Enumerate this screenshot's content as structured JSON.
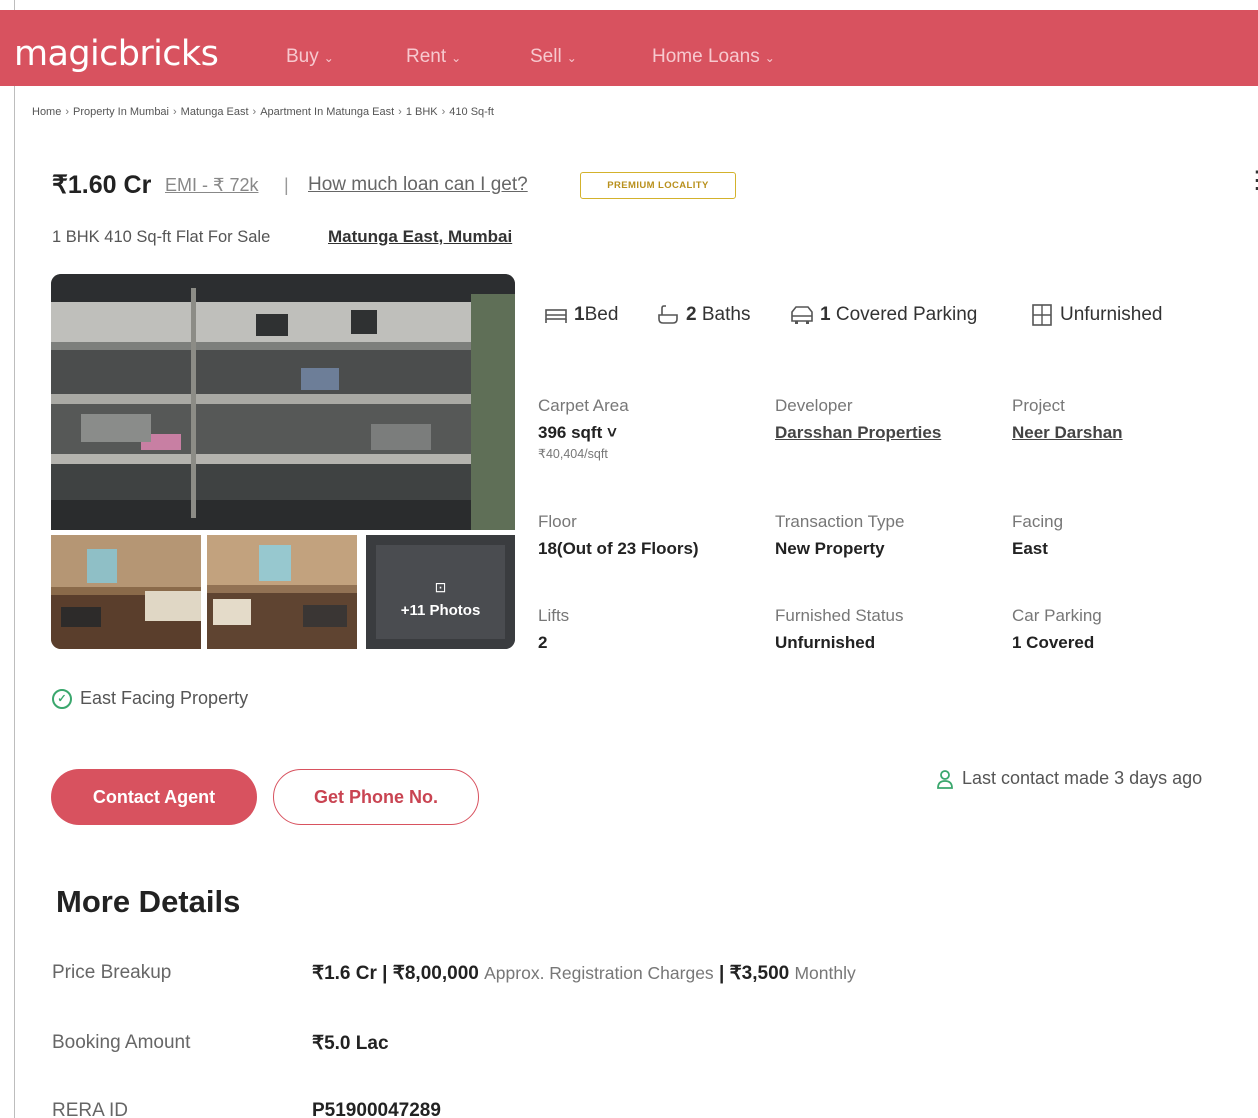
{
  "header": {
    "logo": "magicbricks",
    "nav": [
      {
        "label": "Buy"
      },
      {
        "label": "Rent"
      },
      {
        "label": "Sell"
      },
      {
        "label": "Home Loans"
      }
    ]
  },
  "breadcrumb": [
    "Home",
    "Property In Mumbai",
    "Matunga East",
    "Apartment In Matunga East",
    "1 BHK",
    "410 Sq-ft"
  ],
  "listing": {
    "price": "₹1.60 Cr",
    "emi": "EMI - ₹ 72k",
    "loan_link": "How much loan can I get?",
    "premium_badge": "PREMIUM LOCALITY",
    "subtitle": "1 BHK 410 Sq-ft Flat For Sale",
    "locality": "Matunga East, Mumbai"
  },
  "gallery": {
    "more_photos": "+11 Photos"
  },
  "amenities": {
    "bed_num": "1",
    "bed_label": "Bed",
    "bath_num": "2",
    "bath_label": "Baths",
    "parking_num": "1",
    "parking_label": "Covered Parking",
    "furnishing": "Unfurnished"
  },
  "specs": {
    "carpet_area_label": "Carpet Area",
    "carpet_area_value": "396 sqft ˅",
    "carpet_area_rate": "₹40,404/sqft",
    "developer_label": "Developer",
    "developer_value": "Darsshan Properties",
    "project_label": "Project",
    "project_value": "Neer Darshan",
    "floor_label": "Floor",
    "floor_value": "18(Out of 23 Floors)",
    "transaction_label": "Transaction Type",
    "transaction_value": "New Property",
    "facing_label": "Facing",
    "facing_value": "East",
    "lifts_label": "Lifts",
    "lifts_value": "2",
    "furnished_label": "Furnished Status",
    "furnished_value": "Unfurnished",
    "car_parking_label": "Car Parking",
    "car_parking_value": "1 Covered"
  },
  "highlight": "East Facing Property",
  "actions": {
    "contact_agent": "Contact Agent",
    "get_phone": "Get Phone No.",
    "last_contact": "Last contact made 3 days ago"
  },
  "more_details": {
    "title": "More Details",
    "price_breakup_label": "Price Breakup",
    "price_breakup_price": "₹1.6 Cr",
    "price_breakup_reg": "₹8,00,000",
    "price_breakup_reg_note": "Approx. Registration Charges",
    "price_breakup_monthly": "₹3,500",
    "price_breakup_monthly_note": "Monthly",
    "booking_label": "Booking Amount",
    "booking_value": "₹5.0 Lac",
    "rera_label": "RERA ID",
    "rera_value": "P51900047289"
  },
  "colors": {
    "brand": "#d8525f",
    "premium": "#d3b22c",
    "success": "#3aa76d"
  }
}
